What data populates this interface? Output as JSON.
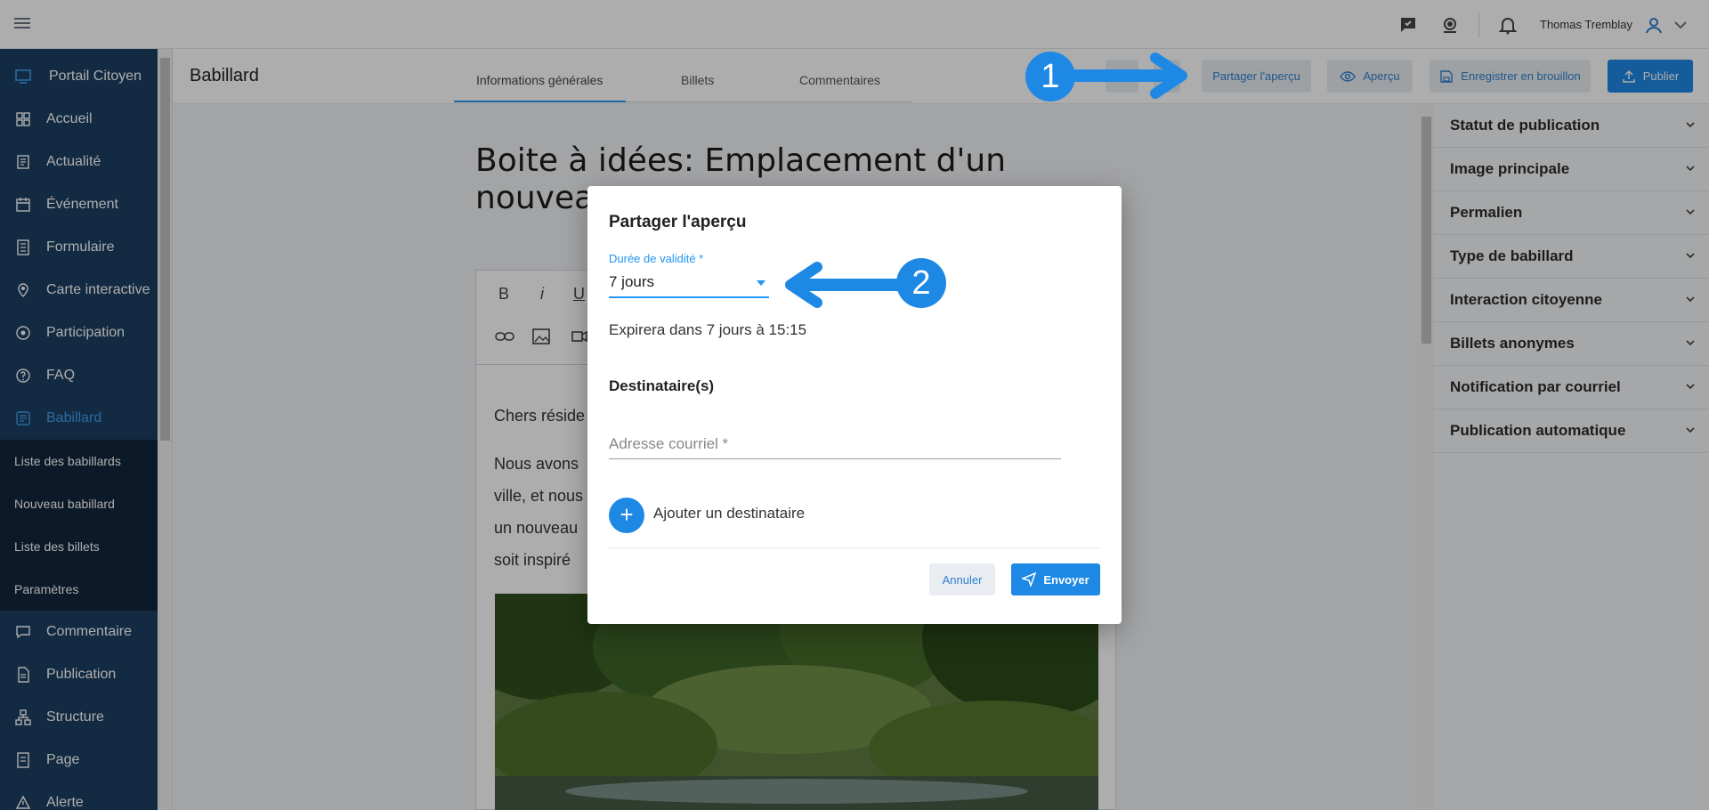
{
  "topbar": {
    "user_name": "Thomas Tremblay"
  },
  "sidebar": {
    "items": [
      {
        "label": "Portail Citoyen"
      },
      {
        "label": "Accueil"
      },
      {
        "label": "Actualité"
      },
      {
        "label": "Événement"
      },
      {
        "label": "Formulaire"
      },
      {
        "label": "Carte interactive"
      },
      {
        "label": "Participation"
      },
      {
        "label": "FAQ"
      },
      {
        "label": "Babillard"
      },
      {
        "label": "Commentaire"
      },
      {
        "label": "Publication"
      },
      {
        "label": "Structure"
      },
      {
        "label": "Page"
      },
      {
        "label": "Alerte"
      }
    ],
    "subitems": [
      {
        "label": "Liste des babillards"
      },
      {
        "label": "Nouveau babillard"
      },
      {
        "label": "Liste des billets"
      },
      {
        "label": "Paramètres"
      }
    ]
  },
  "header": {
    "title": "Babillard",
    "tabs": [
      {
        "label": "Informations générales"
      },
      {
        "label": "Billets"
      },
      {
        "label": "Commentaires"
      }
    ],
    "share_preview_label": "Partager l'aperçu",
    "preview_label": "Aperçu",
    "save_draft_label": "Enregistrer en brouillon",
    "publish_label": "Publier"
  },
  "editor": {
    "doc_title": "Boite à idées: Emplacement d'un nouvea",
    "toolbar": {
      "bold": "B",
      "italic": "i",
      "underline": "U"
    },
    "body_lines": [
      "Chers réside",
      "Nous avons",
      "ville, et nous",
      "un nouveau",
      "soit inspiré"
    ]
  },
  "right_panel": {
    "sections": [
      {
        "label": "Statut de publication"
      },
      {
        "label": "Image principale"
      },
      {
        "label": "Permalien"
      },
      {
        "label": "Type de babillard"
      },
      {
        "label": "Interaction citoyenne"
      },
      {
        "label": "Billets anonymes"
      },
      {
        "label": "Notification par courriel"
      },
      {
        "label": "Publication automatique"
      }
    ]
  },
  "modal": {
    "title": "Partager l'aperçu",
    "validity_label": "Durée de validité *",
    "validity_value": "7 jours",
    "expires_text": "Expirera dans 7 jours à 15:15",
    "recipients_heading": "Destinataire(s)",
    "email_placeholder": "Adresse courriel *",
    "add_recipient_label": "Ajouter un destinataire",
    "cancel_label": "Annuler",
    "send_label": "Envoyer"
  },
  "callouts": [
    {
      "number": "1"
    },
    {
      "number": "2"
    }
  ],
  "colors": {
    "accent": "#1e88e5",
    "sidebar": "#1d3f63",
    "sidebar_sub": "#11253c"
  }
}
